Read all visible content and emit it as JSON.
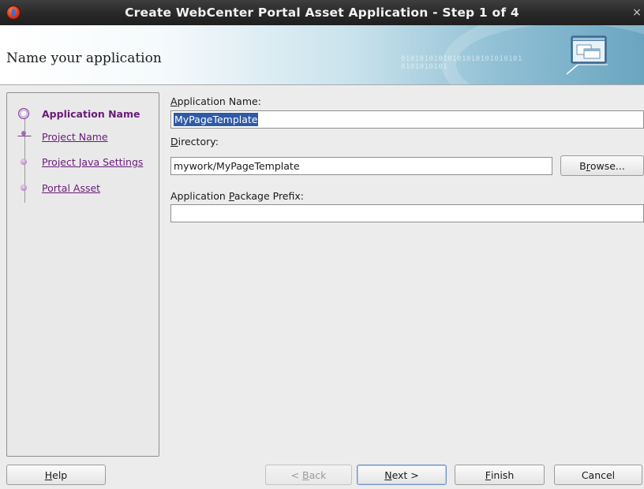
{
  "window": {
    "title": "Create WebCenter Portal Asset Application - Step 1 of 4",
    "close_glyph": "×",
    "app_icon": "jdeveloper-icon"
  },
  "banner": {
    "heading": "Name your application",
    "binary_text": "01010101010101010101010101\n0101010101",
    "icon": "wizard-window-icon"
  },
  "nav": {
    "items": [
      {
        "label": "Application Name",
        "state": "current"
      },
      {
        "label": "Project Name",
        "state": "link"
      },
      {
        "label": "Project Java Settings",
        "state": "link"
      },
      {
        "label": "Portal Asset",
        "state": "link"
      }
    ]
  },
  "form": {
    "app_name": {
      "label_mnemonic": "A",
      "label_rest": "pplication Name:",
      "value": "MyPageTemplate"
    },
    "directory": {
      "label_mnemonic": "D",
      "label_rest": "irectory:",
      "value": "mywork/MyPageTemplate",
      "browse_prefix": "B",
      "browse_mnemonic": "r",
      "browse_suffix": "owse..."
    },
    "package_prefix": {
      "label_prefix": "Application ",
      "label_mnemonic": "P",
      "label_rest": "ackage Prefix:",
      "value": ""
    }
  },
  "footer": {
    "help": {
      "mnemonic": "H",
      "rest": "elp"
    },
    "back": {
      "prefix": "< ",
      "mnemonic": "B",
      "rest": "ack"
    },
    "next": {
      "mnemonic": "N",
      "rest": "ext >"
    },
    "finish": {
      "mnemonic": "F",
      "rest": "inish"
    },
    "cancel": "Cancel"
  }
}
